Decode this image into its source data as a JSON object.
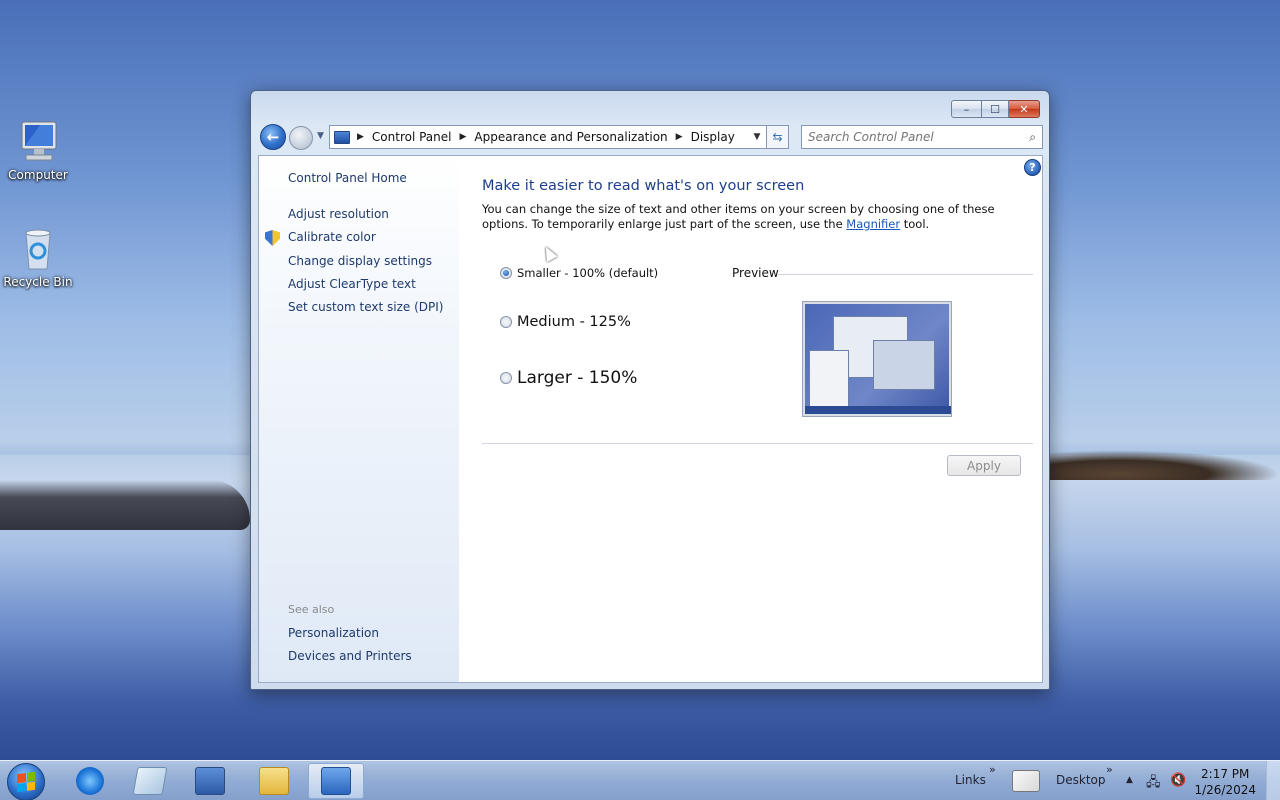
{
  "desktop": {
    "icons": [
      {
        "label": "Computer"
      },
      {
        "label": "Recycle Bin"
      }
    ]
  },
  "window": {
    "breadcrumb": [
      "Control Panel",
      "Appearance and Personalization",
      "Display"
    ],
    "search_placeholder": "Search Control Panel",
    "caption": {
      "minimize": "–",
      "maximize": "☐",
      "close": "✕"
    }
  },
  "sidebar": {
    "home": "Control Panel Home",
    "items": [
      "Adjust resolution",
      "Calibrate color",
      "Change display settings",
      "Adjust ClearType text",
      "Set custom text size (DPI)"
    ],
    "see_also_label": "See also",
    "see_also": [
      "Personalization",
      "Devices and Printers"
    ]
  },
  "main": {
    "heading": "Make it easier to read what's on your screen",
    "desc_before": "You can change the size of text and other items on your screen by choosing one of these options. To temporarily enlarge just part of the screen, use the ",
    "desc_link": "Magnifier",
    "desc_after": " tool.",
    "options": [
      {
        "label": "Smaller - 100% (default)",
        "selected": true
      },
      {
        "label": "Medium - 125%",
        "selected": false
      },
      {
        "label": "Larger - 150%",
        "selected": false
      }
    ],
    "preview_label": "Preview",
    "apply_label": "Apply"
  },
  "taskbar": {
    "links_label": "Links",
    "desktop_label": "Desktop",
    "overflow": "»",
    "time": "2:17 PM",
    "date": "1/26/2024"
  }
}
